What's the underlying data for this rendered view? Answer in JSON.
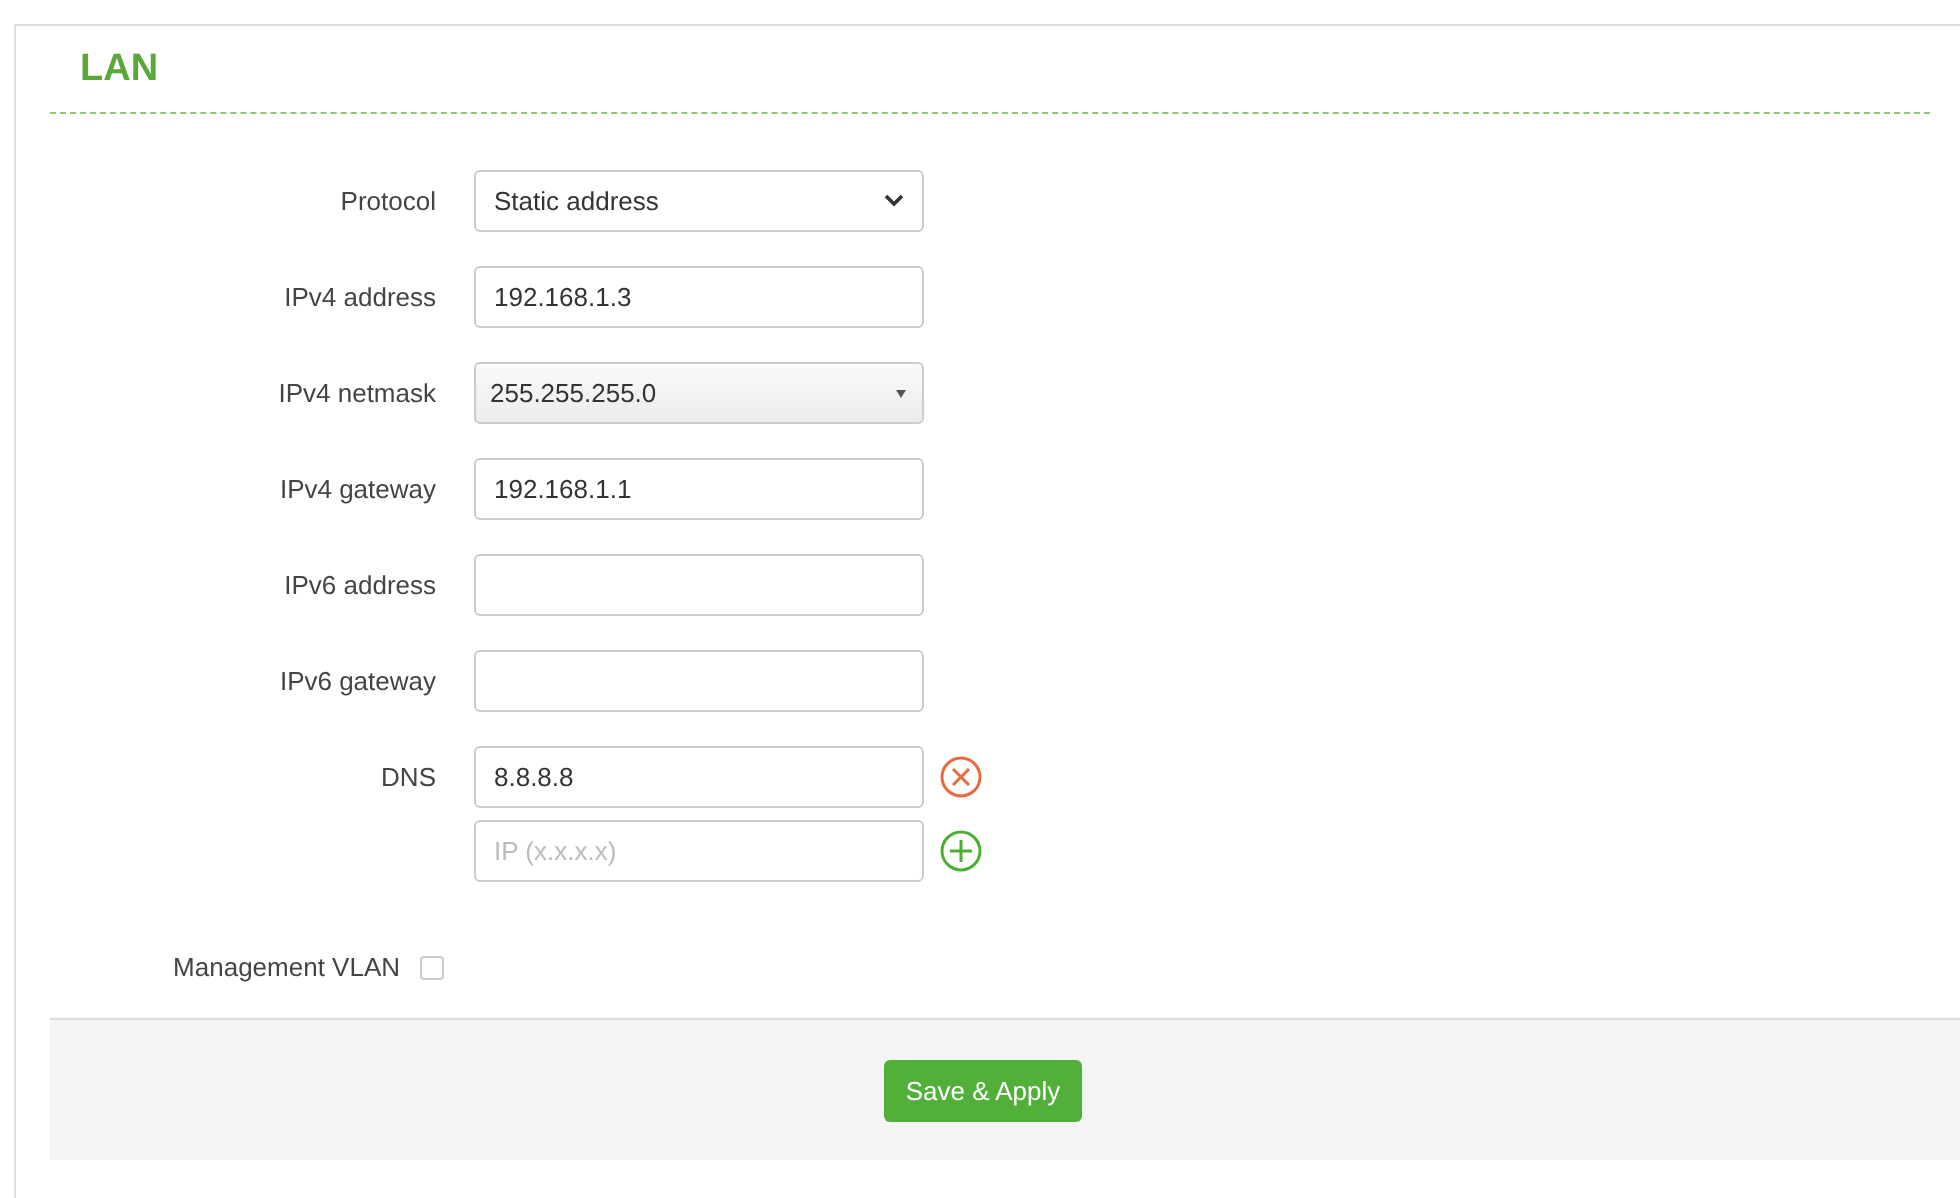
{
  "section": {
    "title": "LAN"
  },
  "fields": [
    {
      "kind": "select",
      "label": "Protocol",
      "value": "Static address"
    },
    {
      "kind": "input",
      "label": "IPv4 address",
      "value": "192.168.1.3"
    },
    {
      "kind": "combo",
      "label": "IPv4 netmask",
      "value": "255.255.255.0"
    },
    {
      "kind": "input",
      "label": "IPv4 gateway",
      "value": "192.168.1.1"
    },
    {
      "kind": "input",
      "label": "IPv6 address"
    },
    {
      "kind": "input",
      "label": "IPv6 gateway"
    },
    {
      "kind": "list",
      "label": "DNS",
      "entries": [
        {
          "value": "8.8.8.8",
          "kind": "remove"
        },
        {
          "placeholder": "IP (x.x.x.x)",
          "kind": "add"
        }
      ]
    },
    {
      "kind": "checkbox",
      "label": "Management VLAN",
      "checked": false
    }
  ],
  "footer": {
    "button": "Save & Apply"
  }
}
